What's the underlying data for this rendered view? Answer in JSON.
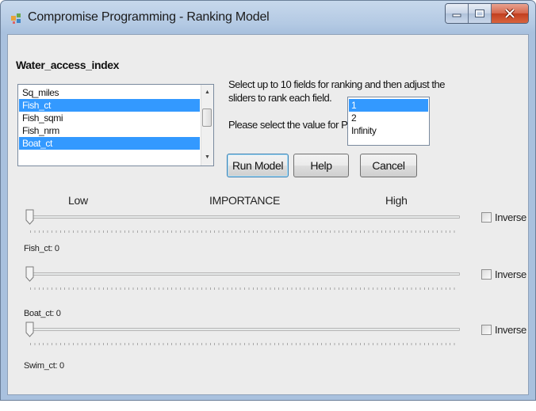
{
  "window": {
    "title": "Compromise Programming - Ranking Model",
    "buttons": [
      "minimize",
      "maximize",
      "close"
    ]
  },
  "dataset_label": "Water_access_index",
  "fields_list": {
    "items": [
      {
        "label": "Sq_miles",
        "selected": false
      },
      {
        "label": "Fish_ct",
        "selected": true
      },
      {
        "label": "Fish_sqmi",
        "selected": false
      },
      {
        "label": "Fish_nrm",
        "selected": false
      },
      {
        "label": "Boat_ct",
        "selected": true
      }
    ]
  },
  "instructions": "Select up to 10 fields for ranking and then adjust the sliders to rank each field.",
  "p_prompt": "Please select the value for P.",
  "p_list": {
    "items": [
      {
        "label": "1",
        "selected": true
      },
      {
        "label": "2",
        "selected": false
      },
      {
        "label": "Infinity",
        "selected": false
      }
    ]
  },
  "buttons": {
    "run": "Run Model",
    "help": "Help",
    "cancel": "Cancel"
  },
  "scale": {
    "low": "Low",
    "center": "IMPORTANCE",
    "high": "High"
  },
  "sliders": [
    {
      "label": "Fish_ct: 0",
      "value": 0,
      "inverse_label": "Inverse",
      "inverse_checked": false
    },
    {
      "label": "Boat_ct: 0",
      "value": 0,
      "inverse_label": "Inverse",
      "inverse_checked": false
    },
    {
      "label": "Swim_ct: 0",
      "value": 0,
      "inverse_label": "Inverse",
      "inverse_checked": false
    }
  ],
  "colors": {
    "selection": "#3399ff",
    "titlebar": "#b3c9e3",
    "close_button": "#c23f1f"
  }
}
